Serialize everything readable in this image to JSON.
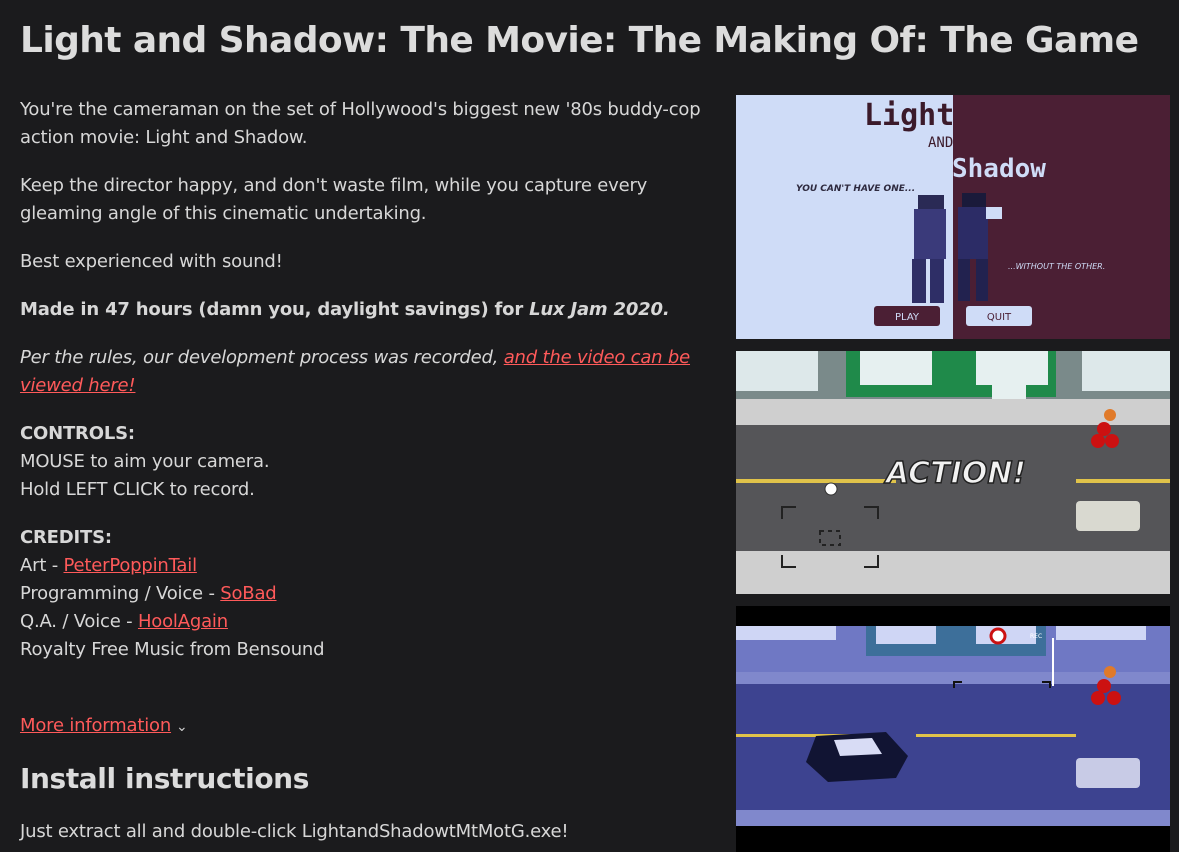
{
  "title": "Light and Shadow: The Movie: The Making Of: The Game",
  "description": {
    "p1": "You're the cameraman on the set of Hollywood's biggest new '80s buddy-cop action movie: Light and Shadow.",
    "p2": "Keep the director happy, and don't waste film, while you capture every gleaming angle of this cinematic undertaking.",
    "p3": "Best experienced with sound!",
    "p4_lead": "Made in 47 hours (damn you, daylight savings) for ",
    "p4_jam": "Lux Jam 2020.",
    "p5_lead": "Per the rules, our development process was recorded, ",
    "p5_link": "and the video can be viewed here!"
  },
  "controls": {
    "heading": "CONTROLS:",
    "line1": "MOUSE to aim your camera.",
    "line2": "Hold LEFT CLICK to record."
  },
  "credits": {
    "heading": "CREDITS:",
    "art_label": "Art - ",
    "art_name": "PeterPoppinTail",
    "prog_label": "Programming / Voice - ",
    "prog_name": "SoBad",
    "qa_label": "Q.A. / Voice - ",
    "qa_name": "HoolAgain",
    "music": "Royalty Free Music from Bensound"
  },
  "more_info": "More information",
  "install": {
    "heading": "Install instructions",
    "text": "Just extract all and double-click LightandShadowtMtMotG.exe!"
  },
  "screenshots": {
    "title_screen": {
      "logo_light": "Light",
      "logo_and": "AND",
      "logo_shadow": "Shadow",
      "tagline_left": "YOU CAN'T HAVE ONE...",
      "tagline_right": "...WITHOUT THE OTHER.",
      "play_button": "PLAY",
      "quit_button": "QUIT"
    },
    "gameplay_banner": "ACTION!",
    "rec_label": "REC"
  },
  "colors": {
    "background": "#1b1b1d",
    "text": "#d7d7d7",
    "link": "#ff5a5a"
  }
}
